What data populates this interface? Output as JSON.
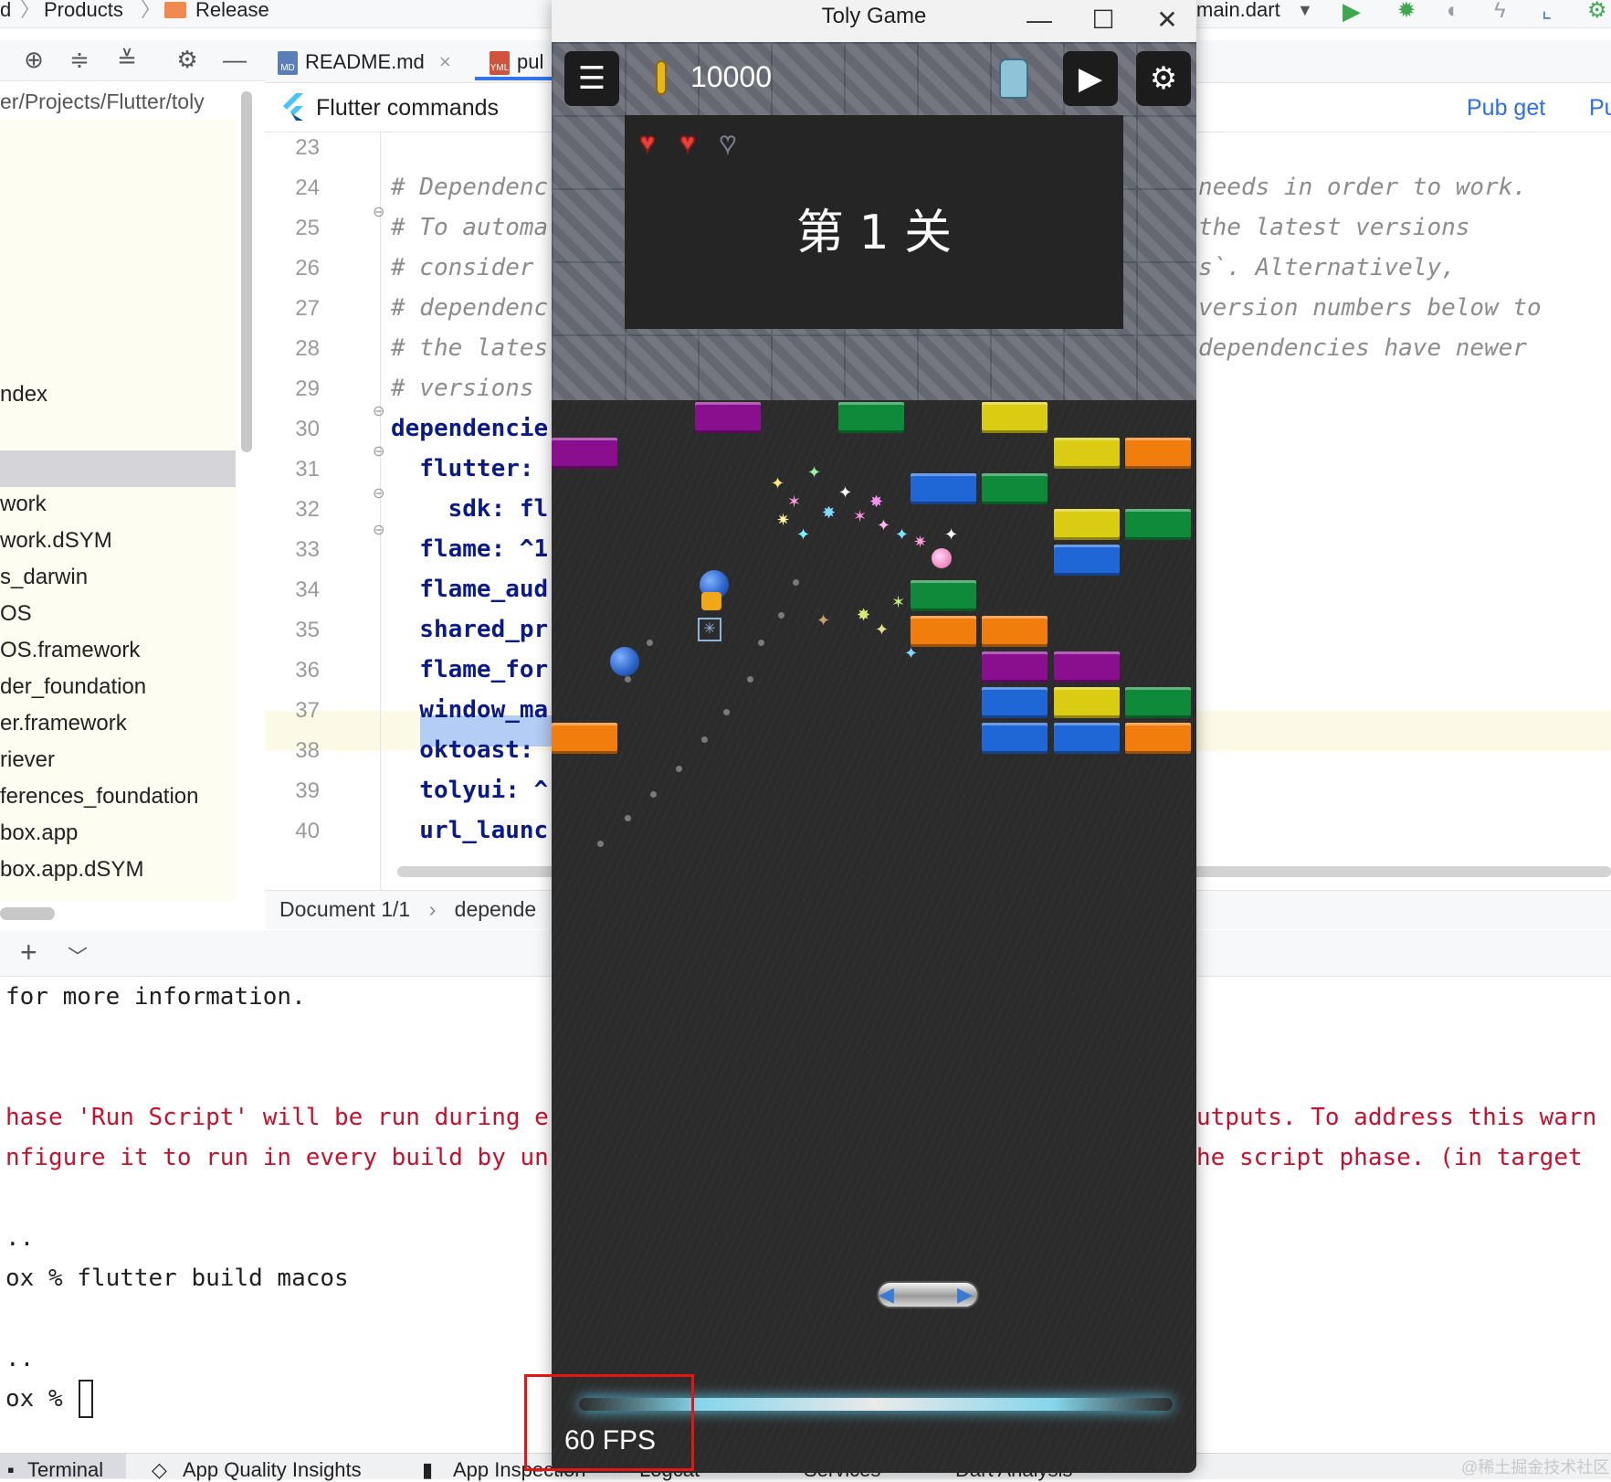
{
  "ide": {
    "breadcrumbs": [
      "d",
      "Products",
      "Release"
    ],
    "run_config": "main.dart",
    "project_path": "er/Projects/Flutter/toly",
    "tree_items": [
      "ndex",
      "work",
      "work.dSYM",
      "s_darwin",
      "OS",
      "OS.framework",
      "der_foundation",
      "er.framework",
      "riever",
      "ferences_foundation",
      "box.app",
      "box.app.dSYM"
    ],
    "tabs": [
      {
        "label": "README.md",
        "badge": "MD"
      },
      {
        "label": "pul",
        "badge": "YML"
      }
    ],
    "command_bar": {
      "title": "Flutter commands",
      "pub_get": "Pub get",
      "pub_upgrade": "Pu"
    },
    "code_lines": [
      {
        "num": "23",
        "left": "",
        "right": ""
      },
      {
        "num": "24",
        "left": "# Dependenc",
        "right": "needs in order to work."
      },
      {
        "num": "25",
        "left": "# To automa",
        "right": "the latest versions"
      },
      {
        "num": "26",
        "left": "# consider ",
        "right": "s`. Alternatively,"
      },
      {
        "num": "27",
        "left": "# dependenc",
        "right": "version numbers below to"
      },
      {
        "num": "28",
        "left": "# the lates",
        "right": "dependencies have newer"
      },
      {
        "num": "29",
        "left": "# versions ",
        "right": ""
      },
      {
        "num": "30",
        "left": "dependencie",
        "right": ""
      },
      {
        "num": "31",
        "left": "  flutter:",
        "right": ""
      },
      {
        "num": "32",
        "left": "    sdk: fl",
        "right": ""
      },
      {
        "num": "33",
        "left": "  flame: ^1",
        "right": ""
      },
      {
        "num": "34",
        "left": "  flame_aud",
        "right": ""
      },
      {
        "num": "35",
        "left": "  shared_pr",
        "right": ""
      },
      {
        "num": "36",
        "left": "  flame_for",
        "right": ""
      },
      {
        "num": "37",
        "left": "  window_ma",
        "right": ""
      },
      {
        "num": "38",
        "left": "  oktoast:",
        "right": ""
      },
      {
        "num": "39",
        "left": "  tolyui: ^",
        "right": ""
      },
      {
        "num": "40",
        "left": "  url_launc",
        "right": ""
      }
    ],
    "breadcrumb": {
      "doc": "Document 1/1",
      "sep": "›",
      "node": "depende"
    },
    "terminal": {
      "lines": [
        {
          "text": "for more information.",
          "red": false
        },
        {
          "text": "hase 'Run Script' will be run during e",
          "red": true
        },
        {
          "text": "nfigure it to run in every build by un",
          "red": true
        },
        {
          "text": "..",
          "red": false
        },
        {
          "text": "ox % flutter build macos",
          "red": false
        },
        {
          "text": "..",
          "red": false
        },
        {
          "text": "ox %",
          "red": false
        }
      ],
      "right_lines": [
        {
          "text": "utputs. To address this warn",
          "red": true
        },
        {
          "text": "he script phase. (in target",
          "red": true
        }
      ]
    },
    "bottom_tabs": [
      "Terminal",
      "App Quality Insights",
      "App Inspection",
      "Logcat",
      "Services",
      "Dart Analysis"
    ],
    "watermark": "@稀土掘金技术社区"
  },
  "game": {
    "title": "Toly Game",
    "score": "10000",
    "level": "第 1 关",
    "hearts": {
      "full": 2,
      "total": 3
    },
    "fps": "60 FPS",
    "bricks": [
      {
        "col": 2,
        "row": 0,
        "color": "#8a0f8f"
      },
      {
        "col": 4,
        "row": 0,
        "color": "#0f8a3a"
      },
      {
        "col": 6,
        "row": 0,
        "color": "#d9cc12"
      },
      {
        "col": 0,
        "row": 1,
        "color": "#8a0f8f"
      },
      {
        "col": 7,
        "row": 1,
        "color": "#d9cc12"
      },
      {
        "col": 8,
        "row": 1,
        "color": "#f07d0c"
      },
      {
        "col": 5,
        "row": 2,
        "color": "#1f66d6"
      },
      {
        "col": 6,
        "row": 2,
        "color": "#0f8a3a"
      },
      {
        "col": 7,
        "row": 3,
        "color": "#d9cc12"
      },
      {
        "col": 8,
        "row": 3,
        "color": "#0f8a3a"
      },
      {
        "col": 7,
        "row": 4,
        "color": "#1f66d6"
      },
      {
        "col": 5,
        "row": 5,
        "color": "#0f8a3a"
      },
      {
        "col": 5,
        "row": 6,
        "color": "#f07d0c"
      },
      {
        "col": 6,
        "row": 6,
        "color": "#f07d0c"
      },
      {
        "col": 6,
        "row": 7,
        "color": "#8a0f8f"
      },
      {
        "col": 7,
        "row": 7,
        "color": "#8a0f8f"
      },
      {
        "col": 6,
        "row": 8,
        "color": "#1f66d6"
      },
      {
        "col": 7,
        "row": 8,
        "color": "#d9cc12"
      },
      {
        "col": 8,
        "row": 8,
        "color": "#0f8a3a"
      },
      {
        "col": 0,
        "row": 9,
        "color": "#f07d0c"
      },
      {
        "col": 6,
        "row": 9,
        "color": "#1f66d6"
      },
      {
        "col": 7,
        "row": 9,
        "color": "#1f66d6"
      },
      {
        "col": 8,
        "row": 9,
        "color": "#f07d0c"
      }
    ],
    "colors": {
      "fps_highlight": "#e31515",
      "accent": "#2f6fe4"
    }
  }
}
